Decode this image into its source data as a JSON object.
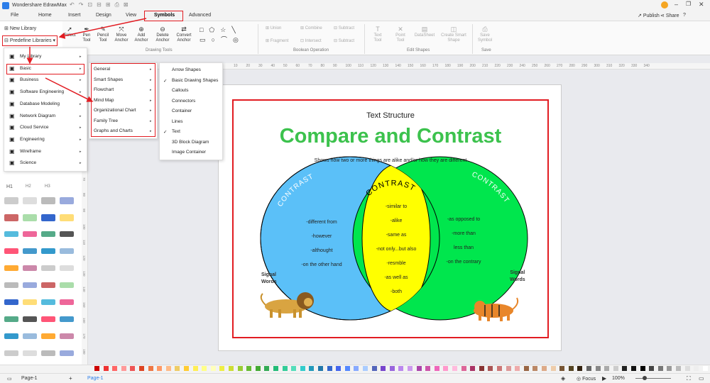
{
  "app": {
    "title": "Wondershare EdrawMax"
  },
  "menu": {
    "file": "File",
    "home": "Home",
    "insert": "Insert",
    "design": "Design",
    "view": "View",
    "symbols": "Symbols",
    "advanced": "Advanced",
    "publish": "Publish",
    "share": "Share"
  },
  "ribbon": {
    "select": "Select",
    "pen": "Pen\nTool",
    "pencil": "Pencil\nTool",
    "move_anchor": "Move\nAnchor",
    "add_anchor": "Add\nAnchor",
    "delete_anchor": "Delete\nAnchor",
    "convert_anchor": "Convert\nAnchor",
    "drawing_tools": "Drawing Tools",
    "union": "Union",
    "combine": "Combine",
    "subtract": "Subtract",
    "fragment": "Fragment",
    "intersect": "Intersect",
    "subtract2": "Subtract",
    "boolean_op": "Boolean Operation",
    "text_tool": "Text\nTool",
    "point_tool": "Point\nTool",
    "datasheet": "DataSheet",
    "create_smart": "Create Smart\nShape",
    "edit_shapes": "Edit Shapes",
    "save_symbol": "Save\nSymbol",
    "save": "Save"
  },
  "left": {
    "new_library": "New Library",
    "predefine": "Predefine Libraries",
    "h1": "H1",
    "h2": "H2",
    "h3": "H3"
  },
  "lib_menu": [
    "My Library",
    "Basic",
    "Business",
    "Software Engineering",
    "Database Modeling",
    "Network Diagram",
    "Cloud Service",
    "Engineering",
    "Wireframe",
    "Science"
  ],
  "basic_menu": [
    "General",
    "Smart Shapes",
    "Flowchart",
    "Mind Map",
    "Organizational Chart",
    "Family Tree",
    "Graphs and Charts"
  ],
  "general_menu": [
    "Arrow Shapes",
    "Basic Drawing Shapes",
    "Callouts",
    "Connectors",
    "Container",
    "Lines",
    "Text",
    "3D Block Diagram",
    "Image Container"
  ],
  "ruler_h": [
    "10",
    "20",
    "30",
    "40",
    "50",
    "60",
    "70",
    "80",
    "90",
    "100",
    "110",
    "120",
    "130",
    "140",
    "150",
    "160",
    "170",
    "180",
    "190",
    "200",
    "210",
    "220",
    "230",
    "240",
    "250",
    "260",
    "270",
    "280",
    "290",
    "300",
    "310",
    "320",
    "330",
    "340"
  ],
  "ruler_v": [
    "10",
    "20",
    "30",
    "40",
    "50",
    "60",
    "70",
    "80",
    "90",
    "100",
    "110",
    "120",
    "130",
    "140",
    "150",
    "160",
    "170",
    "180"
  ],
  "diagram": {
    "heading": "Text Structure",
    "title": "Compare and Contrast",
    "subtitle": "Shows how two or more things are alike and/or how they are different",
    "left_label": "CONTRAST",
    "mid_label": "CONTRAST",
    "right_label": "CONTRAST",
    "left_words": [
      "-different from",
      "-however",
      "-althought",
      "-on the other hand"
    ],
    "mid_words": [
      "-similar to",
      "-alike",
      "-same as",
      "-not only...but also",
      "-resmble",
      "-as well as",
      "-both"
    ],
    "right_words": [
      "-as opposed to",
      "-more than",
      "less than",
      "-on the contrary"
    ],
    "signal_left": "Signal\nWords",
    "signal_right": "Signal\nWords",
    "colors": {
      "left": "#5bc0f8",
      "mid": "#ffff00",
      "right": "#00e64d",
      "title": "#3cc24d"
    }
  },
  "status": {
    "page_tab": "Page-1",
    "page_tab2": "Page-1",
    "focus": "Focus",
    "zoom": "100%"
  }
}
